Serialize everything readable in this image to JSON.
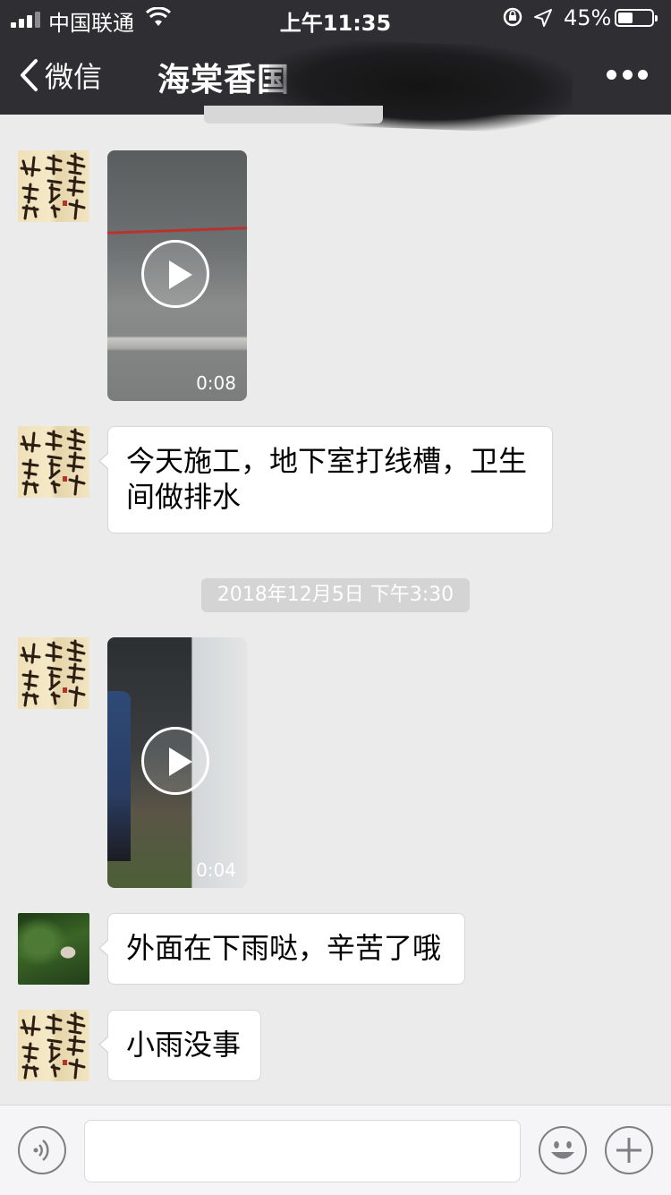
{
  "status_bar": {
    "carrier": "中国联通",
    "time": "上午11:35",
    "battery_percent": "45%",
    "battery_level": 0.45
  },
  "nav": {
    "back_label": "微信",
    "title": "海棠香国"
  },
  "messages": [
    {
      "type": "video",
      "sender": "calligraphy-avatar",
      "duration": "0:08"
    },
    {
      "type": "text",
      "sender": "calligraphy-avatar",
      "text": "今天施工，地下室打线槽，卫生间做排水"
    },
    {
      "type": "timestamp",
      "text": "2018年12月5日 下午3:30"
    },
    {
      "type": "video",
      "sender": "calligraphy-avatar",
      "duration": "0:04"
    },
    {
      "type": "text",
      "sender": "photo-avatar",
      "text": "外面在下雨哒，辛苦了哦"
    },
    {
      "type": "text",
      "sender": "calligraphy-avatar",
      "text": "小雨没事"
    }
  ],
  "avatar_text": {
    "calligraphy": "幸福都是奋斗出来的"
  },
  "input": {
    "value": "",
    "placeholder": ""
  },
  "icons": [
    "signal-icon",
    "wifi-icon",
    "rotation-lock-icon",
    "location-icon",
    "battery-icon",
    "back-chevron-icon",
    "more-icon",
    "play-icon",
    "voice-icon",
    "emoji-icon",
    "plus-icon"
  ],
  "colors": {
    "header_bg": "#2e2e33",
    "chat_bg": "#ebebeb",
    "bubble_bg": "#ffffff",
    "timestamp_bg": "#d4d4d4"
  }
}
